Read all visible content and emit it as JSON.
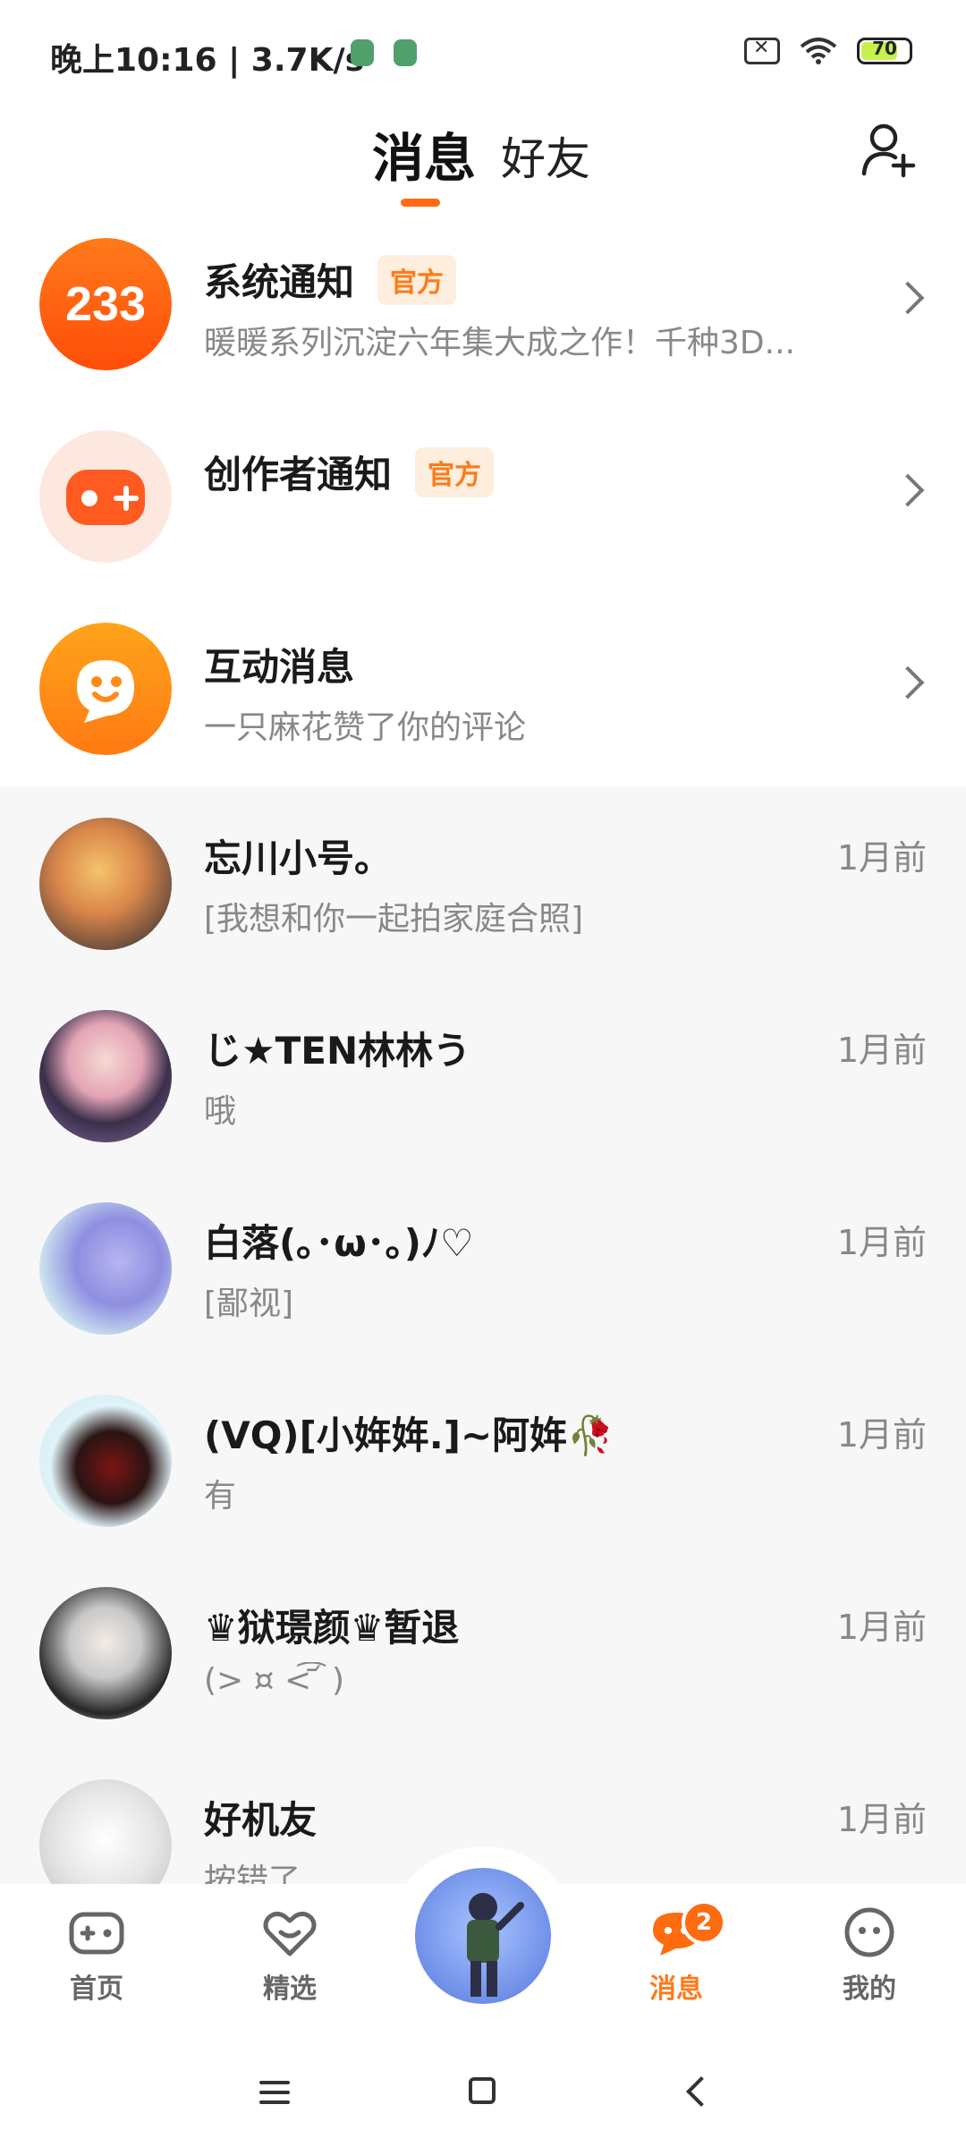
{
  "status_bar": {
    "time": "晚上10:16 | 3.7K/s",
    "battery": "70"
  },
  "header": {
    "tab_messages": "消息",
    "tab_friends": "好友"
  },
  "official": [
    {
      "title": "系统通知",
      "badge": "官方",
      "subtitle": "暖暖系列沉淀六年集大成之作！千种3D...",
      "avatar_text": "233"
    },
    {
      "title": "创作者通知",
      "badge": "官方",
      "subtitle": ""
    },
    {
      "title": "互动消息",
      "badge": "",
      "subtitle": "一只麻花赞了你的评论"
    }
  ],
  "conversations": [
    {
      "name": "忘川小号。",
      "message": "[我想和你一起拍家庭合照]",
      "time": "1月前"
    },
    {
      "name": "じ★TEN林林う",
      "message": "哦",
      "time": "1月前"
    },
    {
      "name": "白落(｡･ω･｡)ﾉ♡",
      "message": "[鄙视]",
      "time": "1月前"
    },
    {
      "name": "(VQ)[小姩姩.]~阿姩🥀",
      "message": "有",
      "time": "1月前"
    },
    {
      "name": "♛狱璟颜♛暂退",
      "message": "(> ¤ <͡ ᷄ )",
      "time": "1月前"
    },
    {
      "name": "好机友",
      "message": "按错了",
      "time": "1月前"
    }
  ],
  "bottom_nav": {
    "home": "首页",
    "featured": "精选",
    "messages": "消息",
    "me": "我的",
    "unread_count": "2"
  },
  "colors": {
    "accent": "#ff6b10",
    "list_bg": "#f7f7f7"
  }
}
